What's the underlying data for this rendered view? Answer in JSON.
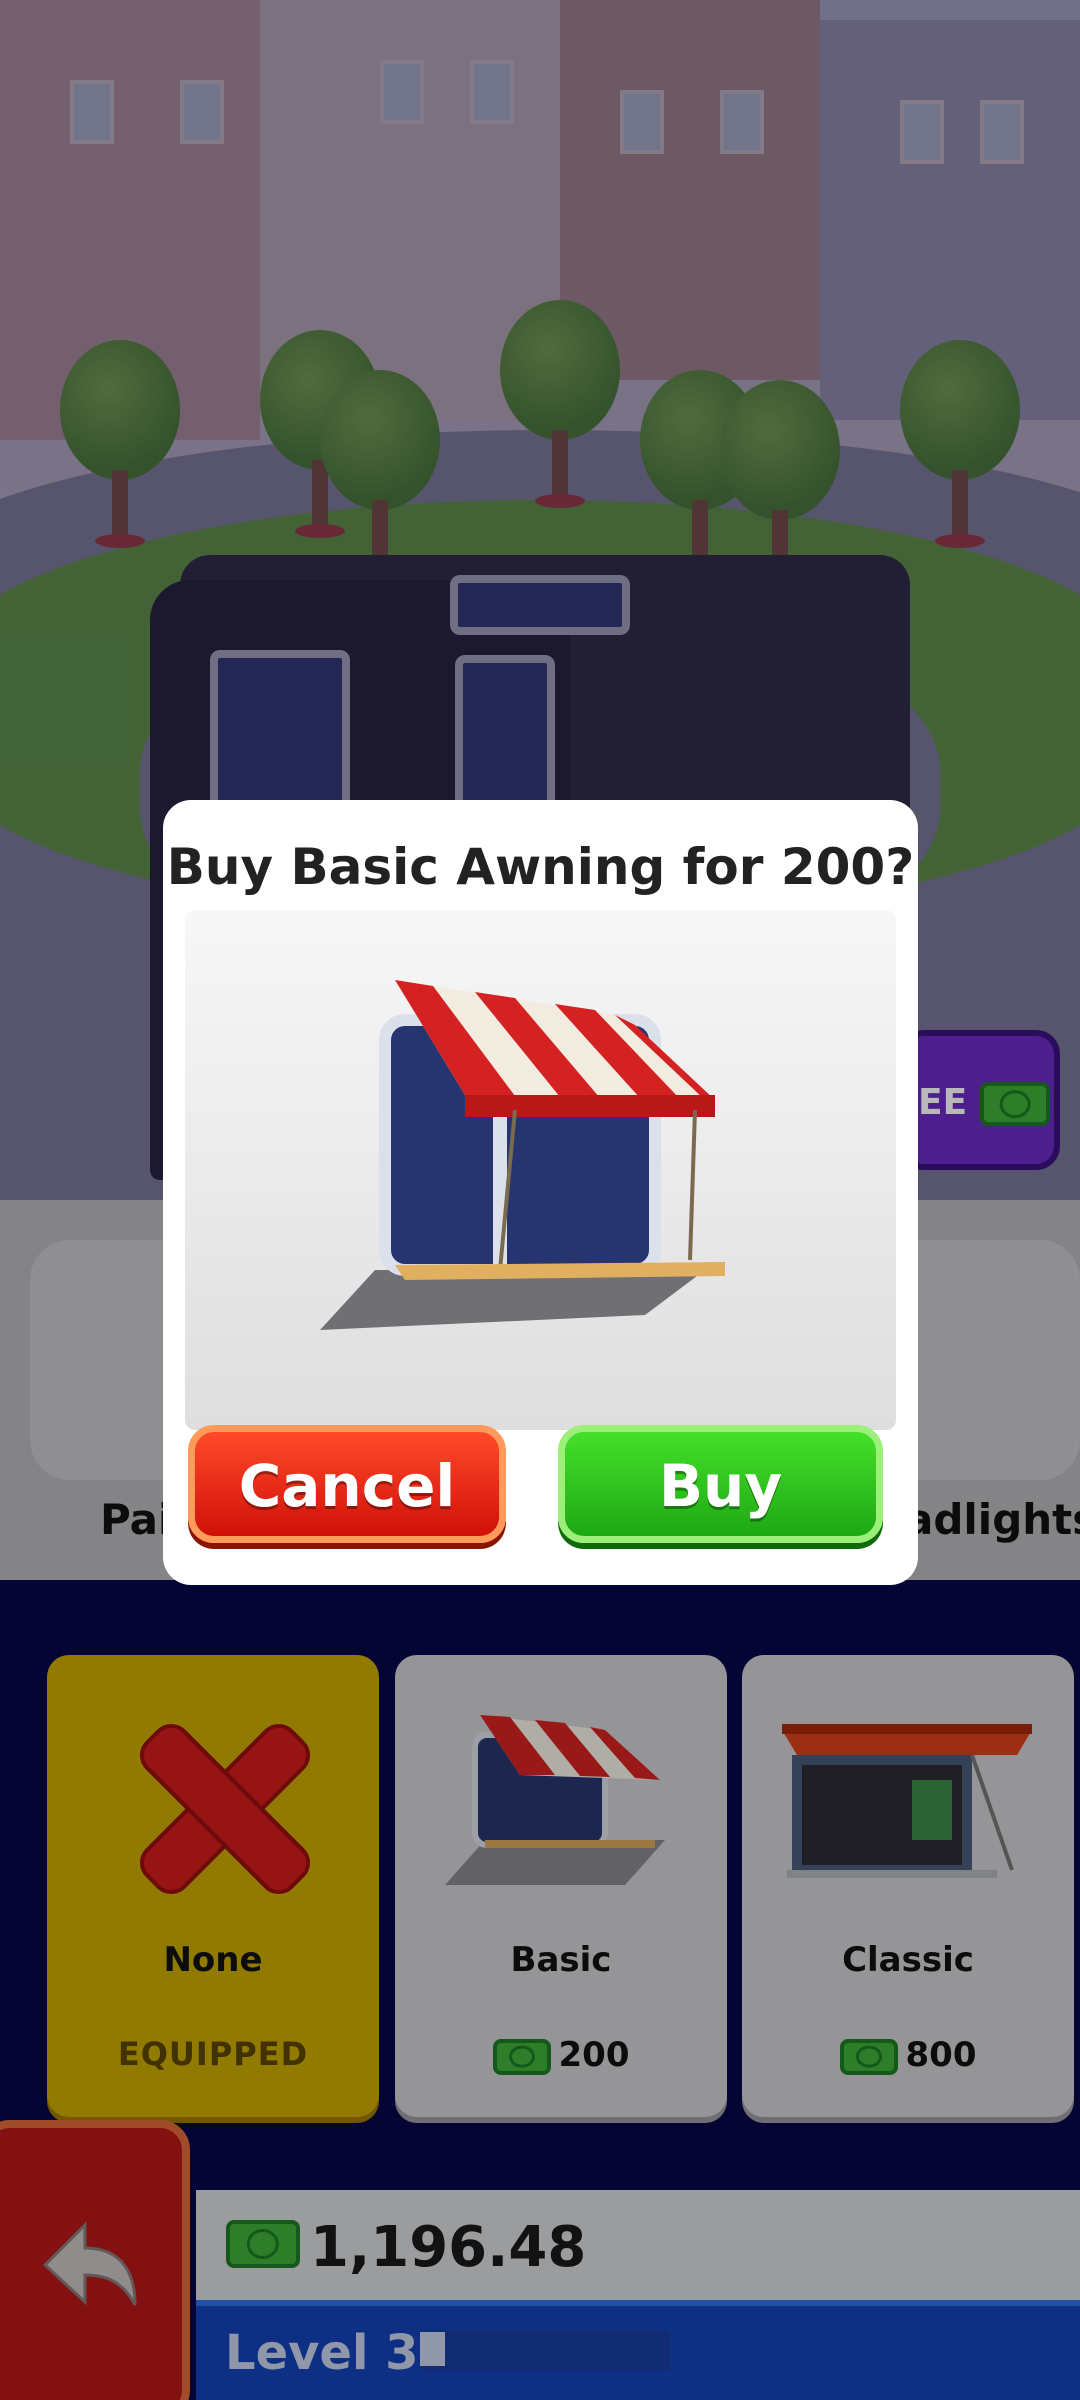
{
  "dialog": {
    "title": "Buy Basic Awning for 200?",
    "cancel_label": "Cancel",
    "buy_label": "Buy"
  },
  "categories": {
    "left_label": "Pai",
    "right_label": "adlights"
  },
  "side_button": {
    "label": "EE"
  },
  "options": [
    {
      "name": "None",
      "status": "EQUIPPED"
    },
    {
      "name": "Basic",
      "price": "200"
    },
    {
      "name": "Classic",
      "price": "800"
    }
  ],
  "wallet": {
    "balance": "1,196.48"
  },
  "level": {
    "label": "Level 3",
    "progress": 0.1
  },
  "colors": {
    "cancel": "#e0200c",
    "buy": "#2cc41a",
    "equipped": "#c9a900",
    "navy": "#06064a"
  }
}
